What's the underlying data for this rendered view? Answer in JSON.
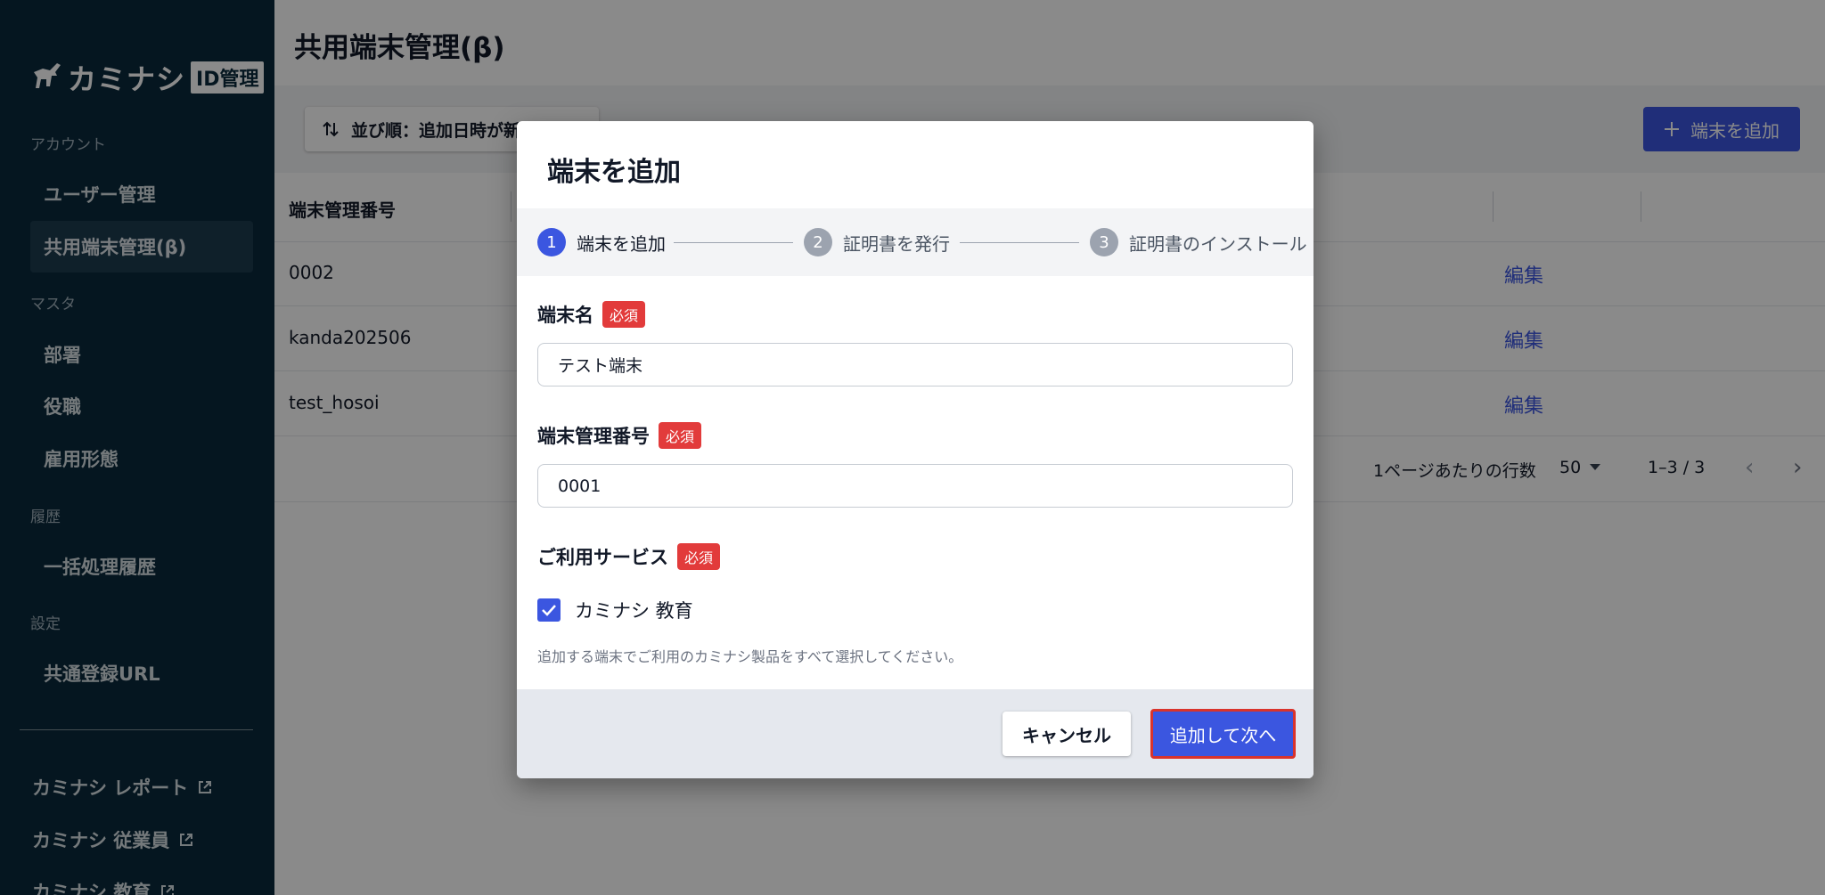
{
  "sidebar": {
    "logo_text": "カミナシ",
    "logo_badge": "ID管理",
    "sections": {
      "account": "アカウント",
      "master": "マスタ",
      "history": "履歴",
      "settings": "設定"
    },
    "items": {
      "users": "ユーザー管理",
      "shared_devices": "共用端末管理(β)",
      "departments": "部署",
      "positions": "役職",
      "employment_types": "雇用形態",
      "batch_history": "一括処理履歴",
      "common_url": "共通登録URL"
    },
    "external_links": [
      "カミナシ レポート",
      "カミナシ 従業員",
      "カミナシ 教育"
    ]
  },
  "main": {
    "page_title": "共用端末管理(β)",
    "sort_label": "並び順：追加日時が新しい順",
    "add_button": "端末を追加",
    "table": {
      "column_header": "端末管理番号",
      "rows": [
        {
          "id": "0002",
          "action": "編集"
        },
        {
          "id": "kanda202506",
          "action": "編集"
        },
        {
          "id": "test_hosoi",
          "action": "編集"
        }
      ]
    },
    "pager": {
      "rows_per_page_label": "1ページあたりの行数",
      "rows_per_page": "50",
      "range": "1–3 / 3"
    }
  },
  "modal": {
    "title": "端末を追加",
    "steps": [
      {
        "num": "1",
        "label": "端末を追加"
      },
      {
        "num": "2",
        "label": "証明書を発行"
      },
      {
        "num": "3",
        "label": "証明書のインストール"
      }
    ],
    "required_badge": "必須",
    "device_name": {
      "label": "端末名",
      "value": "テスト端末"
    },
    "device_number": {
      "label": "端末管理番号",
      "value": "0001"
    },
    "services": {
      "label": "ご利用サービス",
      "option": "カミナシ 教育",
      "checked": true,
      "help": "追加する端末でご利用のカミナシ製品をすべて選択してください。"
    },
    "cancel_button": "キャンセル",
    "next_button": "追加して次へ"
  },
  "colors": {
    "sidebar_bg": "#0b2a3c",
    "primary": "#3b56e0",
    "required": "#e23b3b",
    "highlight_border": "#d9332c"
  },
  "icons": {
    "logo": "goat-logo-icon",
    "sort": "sort-arrows-icon",
    "add": "plus-icon",
    "external": "external-link-icon",
    "check": "check-icon",
    "dropdown": "caret-down-icon",
    "prev": "chevron-left-icon",
    "next": "chevron-right-icon"
  }
}
